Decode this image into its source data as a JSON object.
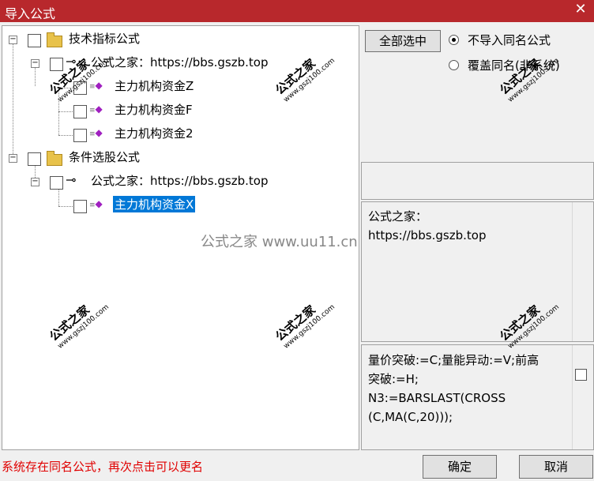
{
  "window": {
    "title": "导入公式",
    "close_glyph": "✕"
  },
  "tree": {
    "groups": [
      {
        "label": "技术指标公式",
        "source": "公式之家：https://bbs.gszb.top",
        "items": [
          "主力机构资金Z",
          "主力机构资金F",
          "主力机构资金2"
        ]
      },
      {
        "label": "条件选股公式",
        "source": "公式之家：https://bbs.gszb.top",
        "items": [
          "主力机构资金X"
        ]
      }
    ]
  },
  "actions": {
    "select_all": "全部选中",
    "radio_no_import": "不导入同名公式",
    "radio_overwrite": "覆盖同名(非系统)",
    "ok": "确定",
    "cancel": "取消"
  },
  "description": {
    "line1": "公式之家：",
    "line2": "https://bbs.gszb.top"
  },
  "code": {
    "line1": "量价突破:=C;量能异动:=V;前高",
    "line2": "突破:=H;",
    "line3": "N3:=BARSLAST(CROSS",
    "line4": "(C,MA(C,20)));"
  },
  "status": "系统存在同名公式，再次点击可以更名",
  "watermarks": {
    "main": "公式之家",
    "url": "www.gszj100.com",
    "center": "公式之家 www.uu11.cn"
  }
}
